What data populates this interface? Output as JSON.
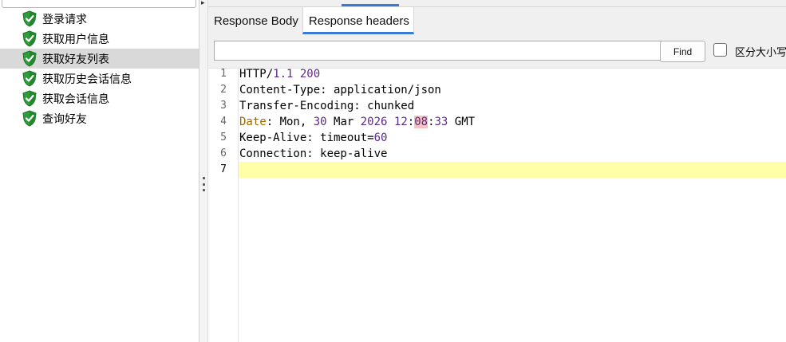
{
  "tree": {
    "items": [
      {
        "label": "登录请求",
        "selected": false
      },
      {
        "label": "获取用户信息",
        "selected": false
      },
      {
        "label": "获取好友列表",
        "selected": true
      },
      {
        "label": "获取历史会话信息",
        "selected": false
      },
      {
        "label": "获取会话信息",
        "selected": false
      },
      {
        "label": "查询好友",
        "selected": false
      }
    ],
    "icon": "shield-check-icon"
  },
  "tabs": [
    {
      "label": "Response Body",
      "active": false
    },
    {
      "label": "Response headers",
      "active": true
    }
  ],
  "search": {
    "value": "",
    "placeholder": "",
    "find_label": "Find",
    "case_label": "区分大小写",
    "case_checked": false
  },
  "editor": {
    "line_numbers": [
      "1",
      "2",
      "3",
      "4",
      "5",
      "6",
      "7"
    ],
    "current_line": 7,
    "lines": {
      "l1": {
        "a": "HTTP/",
        "b": "1.1 200"
      },
      "l2": {
        "a": "Content-Type: application/json"
      },
      "l3": {
        "a": "Transfer-Encoding: chunked"
      },
      "l4": {
        "key": "Date",
        "a": ": Mon, ",
        "day": "30",
        "b": " Mar ",
        "year": "2026",
        "c": " ",
        "hh": "12",
        "colon1": ":",
        "mm": "08",
        "colon2": ":",
        "ss": "33",
        "d": " GMT"
      },
      "l5": {
        "a": "Keep-Alive: timeout=",
        "b": "60"
      },
      "l6": {
        "a": "Connection: keep-alive"
      },
      "l7": {
        "a": ""
      }
    }
  },
  "colors": {
    "accent": "#3a7bd5",
    "selected_row": "#d9d9d9",
    "active_line": "#ffffa8",
    "number": "#5b2a86",
    "date_key": "#9a6a00",
    "match_highlight": "#f6c2c2",
    "shield_green": "#2e9e3c"
  }
}
